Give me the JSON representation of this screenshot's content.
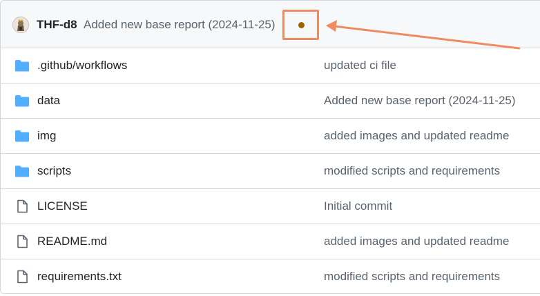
{
  "latest_commit": {
    "author": "THF-d8",
    "message": "Added new base report (2024-11-25)",
    "status_icon": "dot-icon",
    "status_color": "#9a6700",
    "highlight_color": "#ef8a62"
  },
  "files": [
    {
      "type": "folder",
      "icon": "folder-icon",
      "name": ".github/workflows",
      "commit_message": "updated ci file"
    },
    {
      "type": "folder",
      "icon": "folder-icon",
      "name": "data",
      "commit_message": "Added new base report (2024-11-25)"
    },
    {
      "type": "folder",
      "icon": "folder-icon",
      "name": "img",
      "commit_message": "added images and updated readme"
    },
    {
      "type": "folder",
      "icon": "folder-icon",
      "name": "scripts",
      "commit_message": "modified scripts and requirements"
    },
    {
      "type": "file",
      "icon": "file-icon",
      "name": "LICENSE",
      "commit_message": "Initial commit"
    },
    {
      "type": "file",
      "icon": "file-icon",
      "name": "README.md",
      "commit_message": "added images and updated readme"
    },
    {
      "type": "file",
      "icon": "file-icon",
      "name": "requirements.txt",
      "commit_message": "modified scripts and requirements"
    }
  ],
  "colors": {
    "folder": "#54aeff",
    "file": "#59636e",
    "border": "#d0d7de",
    "header_bg": "#f6f8fa"
  }
}
